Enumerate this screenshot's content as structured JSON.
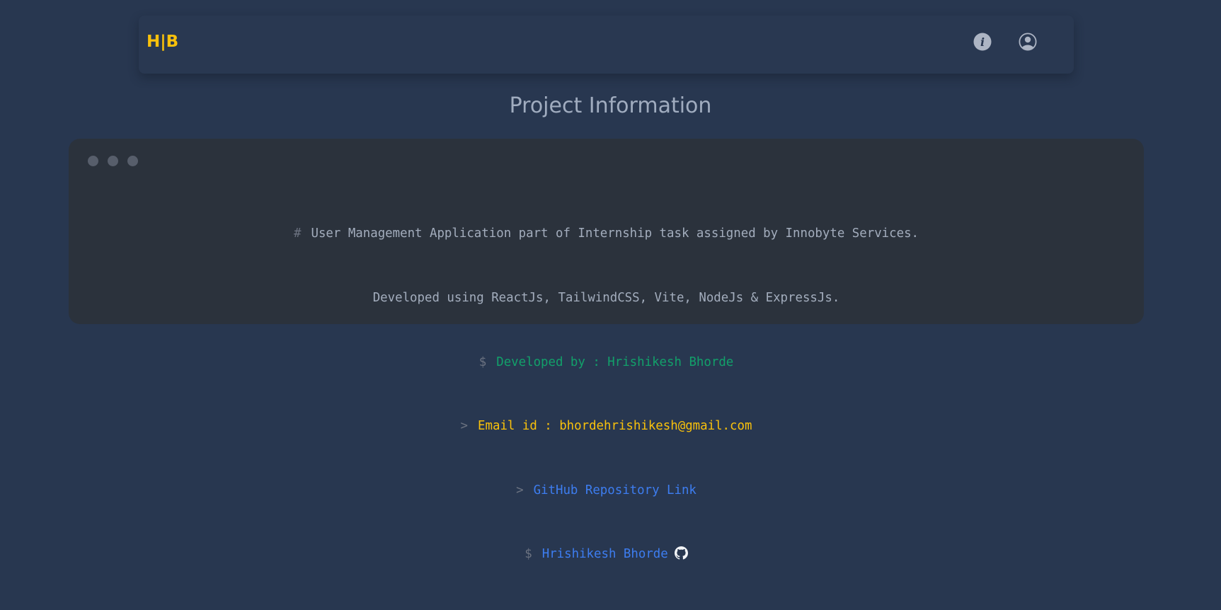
{
  "nav": {
    "logo": "H|B",
    "icons": [
      "info-icon",
      "user-circle-icon"
    ]
  },
  "page_title": "Project Information",
  "terminal": {
    "lines": [
      {
        "prefix": "#",
        "text": "User Management Application part of Internship task assigned by Innobyte Services."
      },
      {
        "prefix": "",
        "text": "Developed using ReactJs, TailwindCSS, Vite, NodeJs & ExpressJs."
      },
      {
        "prefix": "$",
        "text": "Developed by : Hrishikesh Bhorde"
      },
      {
        "prefix": ">",
        "text": "Email id : bhordehrishikesh@gmail.com"
      },
      {
        "prefix": ">",
        "text": "GitHub Repository Link"
      },
      {
        "prefix": "$",
        "text": "Hrishikesh Bhorde"
      }
    ]
  },
  "colors": {
    "background": "#283750",
    "accent": "#f9c10b",
    "green": "#12a06a",
    "blue": "#3d7df0",
    "card": "#2b323c"
  }
}
